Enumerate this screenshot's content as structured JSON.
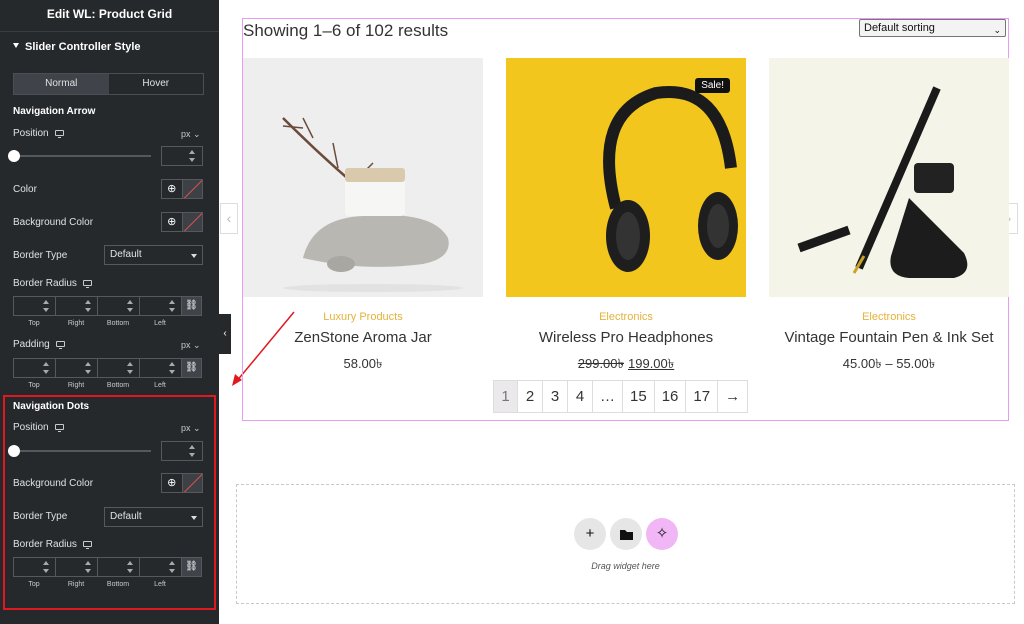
{
  "panel": {
    "title": "Edit WL: Product Grid",
    "section": "Slider Controller Style",
    "tabs": [
      "Normal",
      "Hover"
    ],
    "nav_arrow": {
      "heading": "Navigation Arrow",
      "position_label": "Position",
      "unit": "px",
      "color_label": "Color",
      "bg_color_label": "Background Color",
      "border_type_label": "Border Type",
      "border_type_value": "Default",
      "border_radius_label": "Border Radius",
      "padding_label": "Padding",
      "padding_unit": "px"
    },
    "dim_labels": [
      "Top",
      "Right",
      "Bottom",
      "Left"
    ],
    "nav_dots": {
      "heading": "Navigation Dots",
      "position_label": "Position",
      "unit": "px",
      "bg_color_label": "Background Color",
      "border_type_label": "Border Type",
      "border_type_value": "Default",
      "border_radius_label": "Border Radius"
    },
    "link_icon": "link-icon",
    "globe_icon": "globe-icon",
    "highlight_color": "#e0191f"
  },
  "main": {
    "showing": "Showing 1–6 of 102 results",
    "sort": "Default sorting",
    "products": [
      {
        "category": "Luxury Products",
        "name": "ZenStone Aroma Jar",
        "price": "58.00৳"
      },
      {
        "category": "Electronics",
        "name": "Wireless Pro Headphones",
        "old_price": "299.00৳",
        "new_price": "199.00৳",
        "badge": "Sale!"
      },
      {
        "category": "Electronics",
        "name": "Vintage Fountain Pen & Ink Set",
        "price": "45.00৳ – 55.00৳"
      }
    ],
    "pagination": [
      "1",
      "2",
      "3",
      "4",
      "…",
      "15",
      "16",
      "17",
      "→"
    ],
    "drop_text": "Drag widget here",
    "accent_color": "#e5b23a"
  }
}
